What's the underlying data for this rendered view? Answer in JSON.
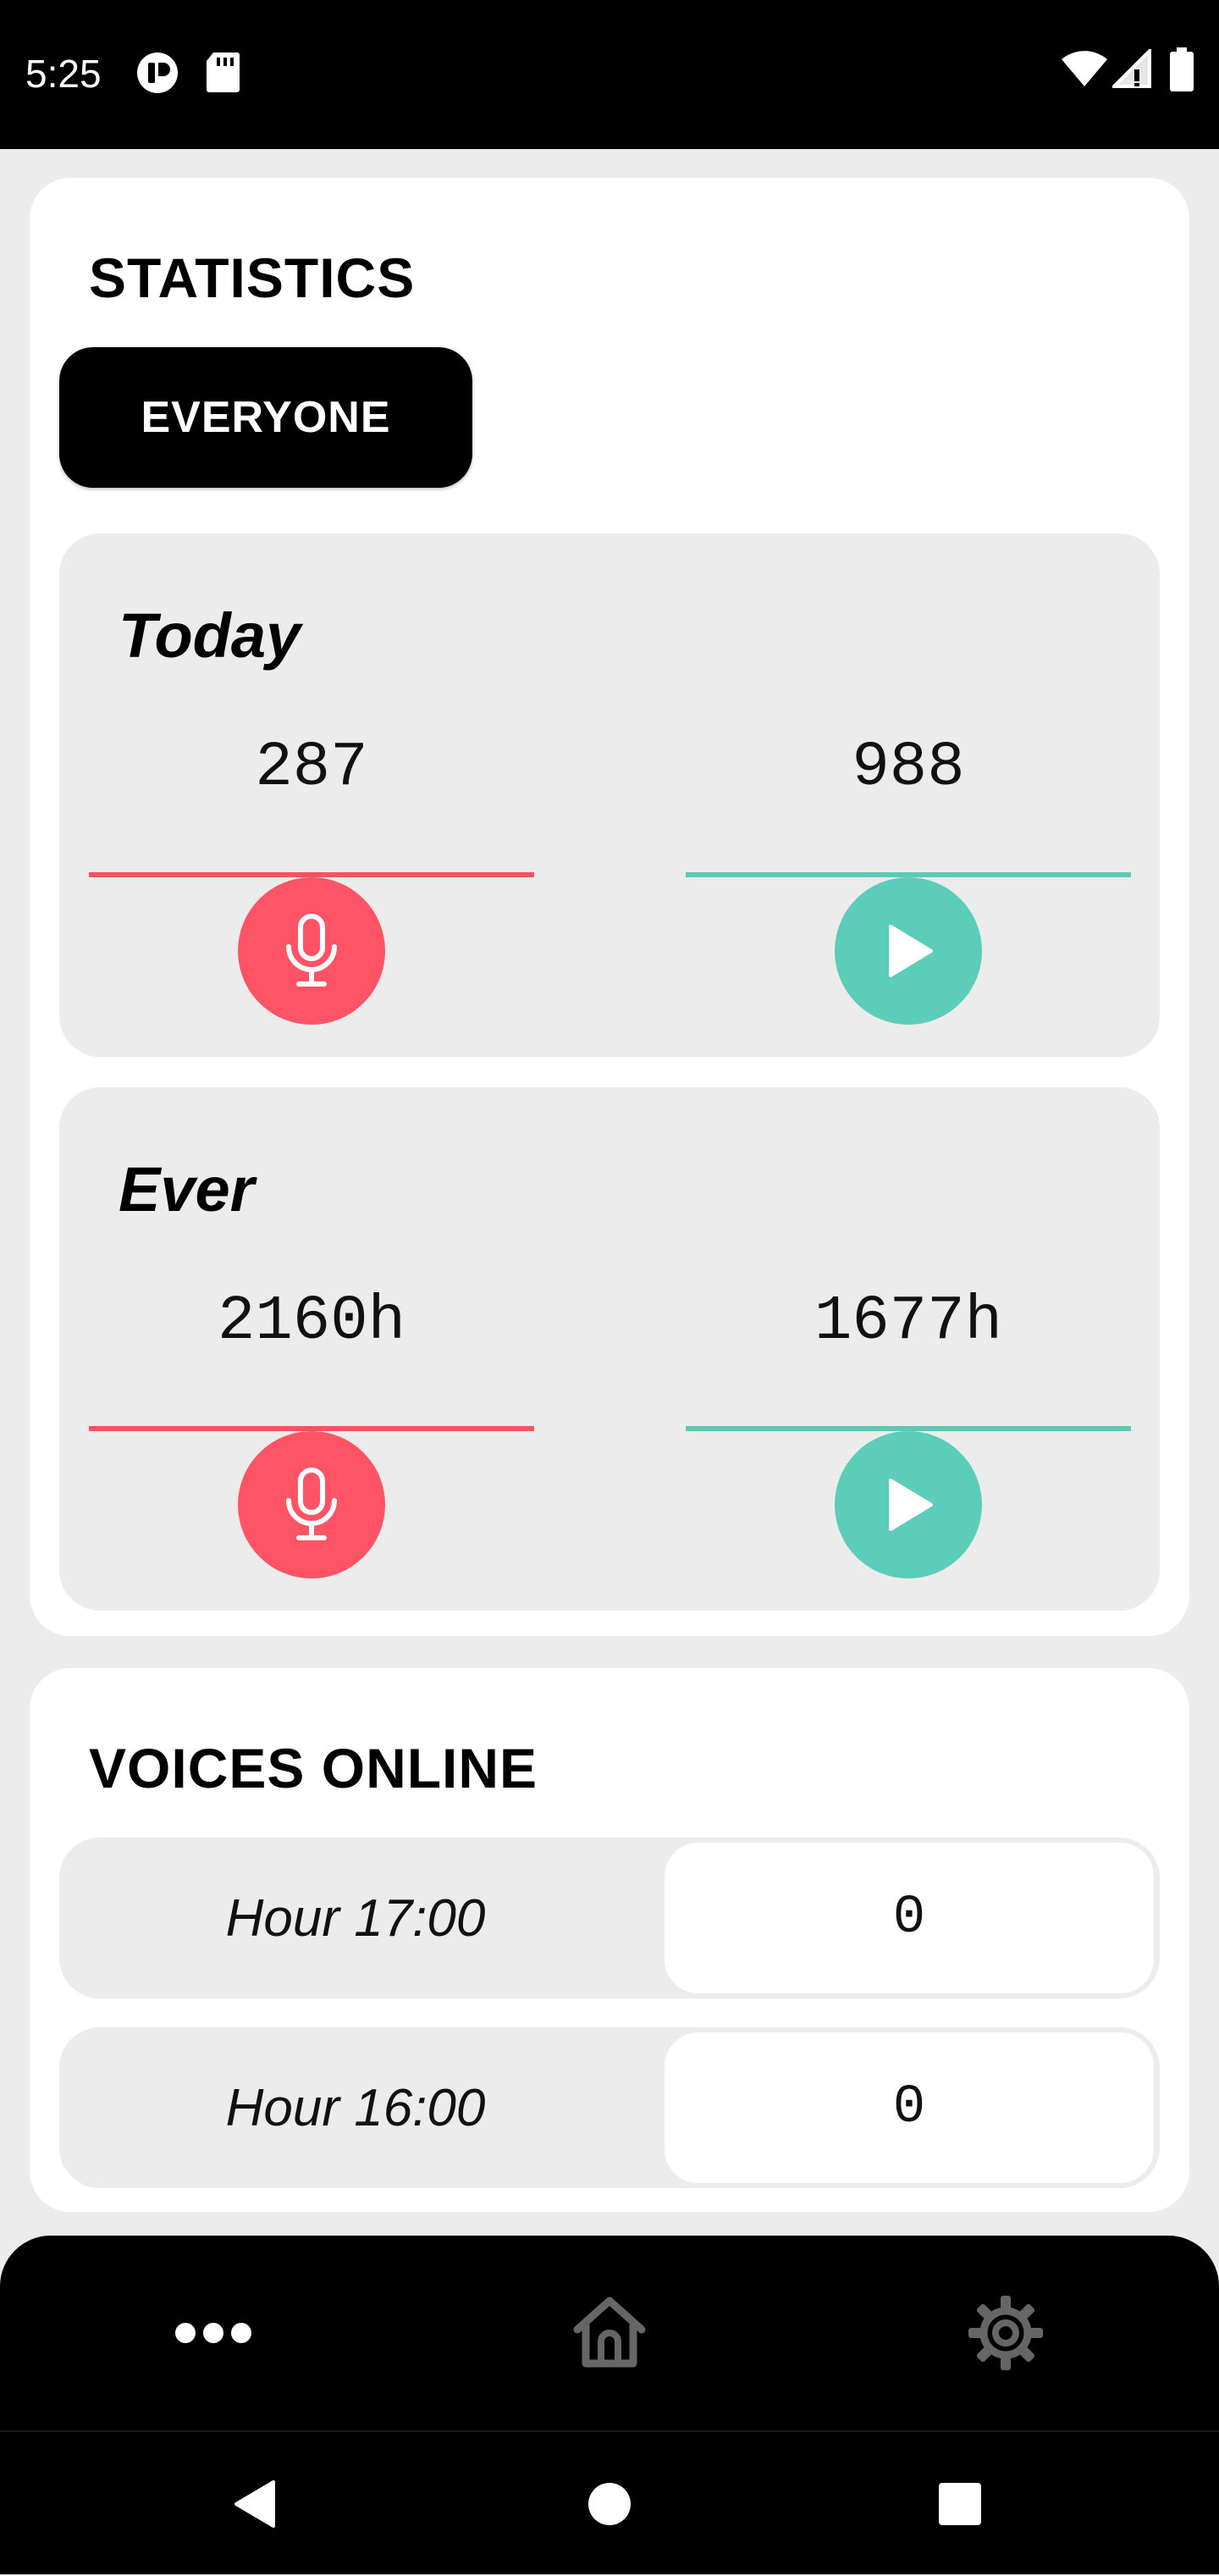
{
  "status_bar": {
    "time": "5:25",
    "left_icons": [
      "app-notification-icon",
      "sd-card-icon"
    ],
    "right_icons": [
      "wifi-icon",
      "cellular-signal-icon",
      "battery-icon"
    ]
  },
  "statistics": {
    "title": "STATISTICS",
    "filter_label": "EVERYONE",
    "today": {
      "label": "Today",
      "recorded": "287",
      "listened": "988"
    },
    "ever": {
      "label": "Ever",
      "recorded": "2160h",
      "listened": "1677h"
    }
  },
  "voices_online": {
    "title": "VOICES ONLINE",
    "rows": [
      {
        "hour": "Hour 17:00",
        "count": "0"
      },
      {
        "hour": "Hour 16:00",
        "count": "0"
      }
    ]
  },
  "bottom_nav": {
    "items": [
      "more-icon",
      "home-icon",
      "settings-icon"
    ]
  },
  "colors": {
    "record_red": "#ff5466",
    "listen_teal": "#5ccdb8",
    "background": "#ececec"
  }
}
